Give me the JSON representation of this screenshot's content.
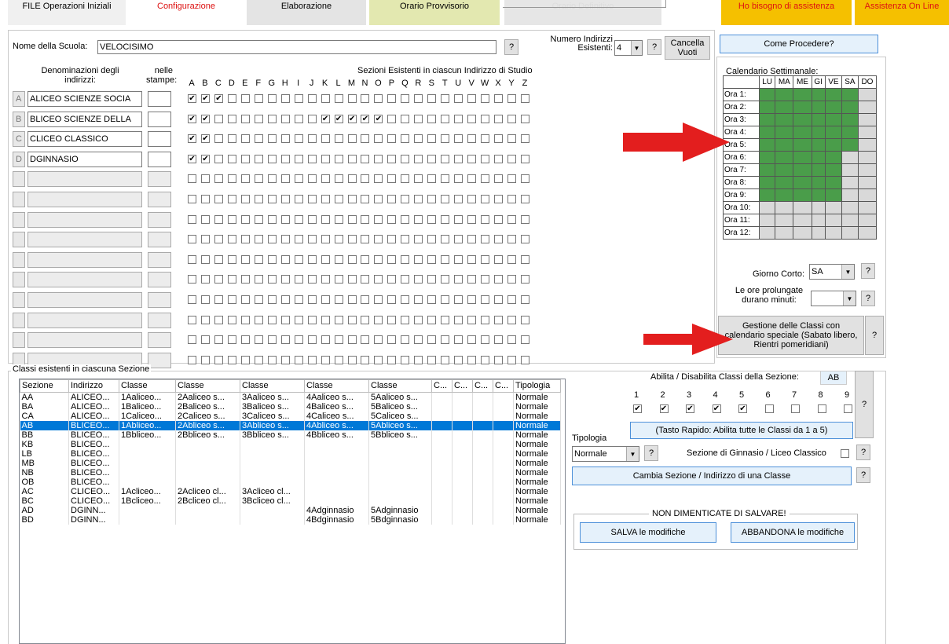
{
  "tabs": [
    {
      "label": "FILE Operazioni Iniziali",
      "bg": "#f0f0f0",
      "color": "#000"
    },
    {
      "label": "Configurazione",
      "bg": "#ffffff",
      "color": "#d11"
    },
    {
      "label": "Elaborazione",
      "bg": "#e4e4e4",
      "color": "#000"
    },
    {
      "label": "Orario Provvisorio",
      "bg": "#e3e8b0",
      "color": "#000"
    },
    {
      "label": "Orario Definitivo",
      "bg": "#e6e6e6",
      "color": "#ddd"
    }
  ],
  "help_tabs": [
    "Ho bisogno di assistenza",
    "Assistenza On Line"
  ],
  "school": {
    "label": "Nome della Scuola:",
    "value": "VELOCISIMO"
  },
  "num_indirizzi": {
    "label": "Numero Indirizzi Esistenti:",
    "value": "4"
  },
  "cancella_label": "Cancella Vuoti",
  "come_procedere": "Come Procedere?",
  "qmark": "?",
  "headers": {
    "denominazioni": "Denominazioni degli indirizzi:",
    "stampe": "nelle stampe:",
    "sezioni": "Sezioni Esistenti in ciascun Indirizzo di Studio"
  },
  "letters": [
    "A",
    "B",
    "C",
    "D",
    "E",
    "F",
    "G",
    "H",
    "I",
    "J",
    "K",
    "L",
    "M",
    "N",
    "O",
    "P",
    "Q",
    "R",
    "S",
    "T",
    "U",
    "V",
    "W",
    "X",
    "Y",
    "Z"
  ],
  "indirizzi": [
    {
      "tag": "A",
      "name": "ALICEO SCIENZE SOCIA",
      "checked": [
        "A",
        "B",
        "C"
      ]
    },
    {
      "tag": "B",
      "name": "BLICEO SCIENZE DELLA",
      "checked": [
        "A",
        "B",
        "K",
        "L",
        "M",
        "N",
        "O"
      ]
    },
    {
      "tag": "C",
      "name": "CLICEO CLASSICO",
      "checked": [
        "A",
        "B"
      ]
    },
    {
      "tag": "D",
      "name": "DGINNASIO",
      "checked": [
        "A",
        "B"
      ]
    }
  ],
  "empty_rows": 10,
  "calendar": {
    "title": "Calendario Settimanale:",
    "days": [
      "LU",
      "MA",
      "ME",
      "GI",
      "VE",
      "SA",
      "DO"
    ],
    "rows": [
      {
        "label": "Ora 1:",
        "on": [
          1,
          1,
          1,
          1,
          1,
          1,
          0
        ]
      },
      {
        "label": "Ora 2:",
        "on": [
          1,
          1,
          1,
          1,
          1,
          1,
          0
        ]
      },
      {
        "label": "Ora 3:",
        "on": [
          1,
          1,
          1,
          1,
          1,
          1,
          0
        ]
      },
      {
        "label": "Ora 4:",
        "on": [
          1,
          1,
          1,
          1,
          1,
          1,
          0
        ]
      },
      {
        "label": "Ora 5:",
        "on": [
          1,
          1,
          1,
          1,
          1,
          1,
          0
        ]
      },
      {
        "label": "Ora 6:",
        "on": [
          1,
          1,
          1,
          1,
          1,
          0,
          0
        ]
      },
      {
        "label": "Ora 7:",
        "on": [
          1,
          1,
          1,
          1,
          1,
          0,
          0
        ]
      },
      {
        "label": "Ora 8:",
        "on": [
          1,
          1,
          1,
          1,
          1,
          0,
          0
        ]
      },
      {
        "label": "Ora 9:",
        "on": [
          1,
          1,
          1,
          1,
          1,
          0,
          0
        ]
      },
      {
        "label": "Ora 10:",
        "on": [
          0,
          0,
          0,
          0,
          0,
          0,
          0
        ]
      },
      {
        "label": "Ora 11:",
        "on": [
          0,
          0,
          0,
          0,
          0,
          0,
          0
        ]
      },
      {
        "label": "Ora 12:",
        "on": [
          0,
          0,
          0,
          0,
          0,
          0,
          0
        ]
      }
    ],
    "on_color": "#4a9d4a",
    "off_color": "#d9d9d9"
  },
  "giorno_corto": {
    "label": "Giorno Corto:",
    "value": "SA"
  },
  "ore_prolungate": {
    "label": "Le ore prolungate durano minuti:",
    "value": ""
  },
  "gestione_label": "Gestione delle Classi con calendario speciale (Sabato libero, Rientri pomeridiani)",
  "classi_group": "Classi esistenti in ciascuna Sezione",
  "columns": [
    "Sezione",
    "Indirizzo",
    "Classe",
    "Classe",
    "Classe",
    "Classe",
    "Classe",
    "C...",
    "C...",
    "C...",
    "C...",
    "Tipologia"
  ],
  "classi_rows": [
    [
      "AA",
      "ALICEO...",
      "1Aaliceo...",
      "2Aaliceo s...",
      "3Aaliceo s...",
      "4Aaliceo s...",
      "5Aaliceo s...",
      "",
      "",
      "",
      "",
      "Normale"
    ],
    [
      "BA",
      "ALICEO...",
      "1Baliceo...",
      "2Baliceo s...",
      "3Baliceo s...",
      "4Baliceo s...",
      "5Baliceo s...",
      "",
      "",
      "",
      "",
      "Normale"
    ],
    [
      "CA",
      "ALICEO...",
      "1Caliceo...",
      "2Caliceo s...",
      "3Caliceo s...",
      "4Caliceo s...",
      "5Caliceo s...",
      "",
      "",
      "",
      "",
      "Normale"
    ],
    [
      "AB",
      "BLICEO...",
      "1Abliceo...",
      "2Abliceo s...",
      "3Abliceo s...",
      "4Abliceo s...",
      "5Abliceo s...",
      "",
      "",
      "",
      "",
      "Normale"
    ],
    [
      "BB",
      "BLICEO...",
      "1Bbliceo...",
      "2Bbliceo s...",
      "3Bbliceo s...",
      "4Bbliceo s...",
      "5Bbliceo s...",
      "",
      "",
      "",
      "",
      "Normale"
    ],
    [
      "KB",
      "BLICEO...",
      "",
      "",
      "",
      "",
      "",
      "",
      "",
      "",
      "",
      "Normale"
    ],
    [
      "LB",
      "BLICEO...",
      "",
      "",
      "",
      "",
      "",
      "",
      "",
      "",
      "",
      "Normale"
    ],
    [
      "MB",
      "BLICEO...",
      "",
      "",
      "",
      "",
      "",
      "",
      "",
      "",
      "",
      "Normale"
    ],
    [
      "NB",
      "BLICEO...",
      "",
      "",
      "",
      "",
      "",
      "",
      "",
      "",
      "",
      "Normale"
    ],
    [
      "OB",
      "BLICEO...",
      "",
      "",
      "",
      "",
      "",
      "",
      "",
      "",
      "",
      "Normale"
    ],
    [
      "AC",
      "CLICEO...",
      "1Acliceo...",
      "2Acliceo cl...",
      "3Acliceo cl...",
      "",
      "",
      "",
      "",
      "",
      "",
      "Normale"
    ],
    [
      "BC",
      "CLICEO...",
      "1Bcliceo...",
      "2Bcliceo cl...",
      "3Bcliceo cl...",
      "",
      "",
      "",
      "",
      "",
      "",
      "Normale"
    ],
    [
      "AD",
      "DGINN...",
      "",
      "",
      "",
      "4Adginnasio",
      "5Adginnasio",
      "",
      "",
      "",
      "",
      "Normale"
    ],
    [
      "BD",
      "DGINN...",
      "",
      "",
      "",
      "4Bdginnasio",
      "5Bdginnasio",
      "",
      "",
      "",
      "",
      "Normale"
    ]
  ],
  "selected_row": 3,
  "abilita": {
    "label": "Abilita / Disabilita Classi della Sezione:",
    "sezione": "AB",
    "numbers": [
      "1",
      "2",
      "3",
      "4",
      "5",
      "6",
      "7",
      "8",
      "9"
    ],
    "checked": [
      1,
      1,
      1,
      1,
      1,
      0,
      0,
      0,
      0
    ]
  },
  "tasto_rapido": "(Tasto Rapido: Abilita tutte le Classi da 1 a 5)",
  "tipologia": {
    "label": "Tipologia",
    "value": "Normale"
  },
  "ginnasio_label": "Sezione di Ginnasio / Liceo Classico",
  "cambia_label": "Cambia Sezione / Indirizzo di una Classe",
  "salvare": {
    "title": "NON DIMENTICATE DI SALVARE!",
    "salva": "SALVA le modifiche",
    "abbandona": "ABBANDONA le modifiche"
  }
}
